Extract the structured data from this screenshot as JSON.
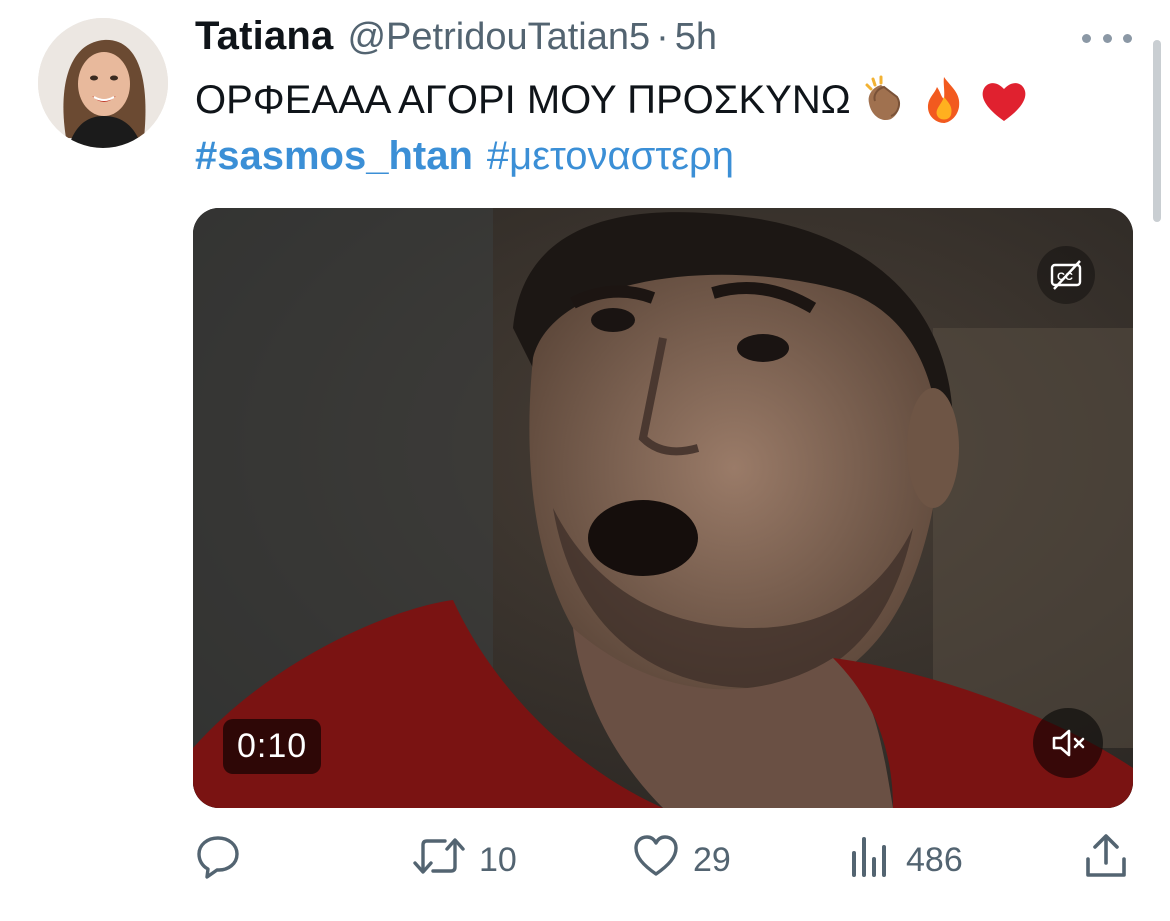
{
  "tweet": {
    "author_name": "Tatiana",
    "author_handle": "@PetridouTatian5",
    "separator": "·",
    "time": "5h",
    "text": "ΟΡΦΕΑΑΑ ΑΓΟΡΙ ΜΟΥ ΠΡΟΣΚΥΝΩ",
    "emojis": [
      "clapping-hands-emoji",
      "fire-emoji",
      "red-heart-emoji"
    ],
    "hashtags": [
      "#sasmos_htan",
      "#μετοναστερη"
    ]
  },
  "media": {
    "type": "video",
    "duration": "0:10",
    "captions_icon": "captions-off-icon",
    "volume_icon": "volume-muted-icon"
  },
  "actions": {
    "reply_count": "",
    "retweet_count": "10",
    "like_count": "29",
    "views_count": "486"
  },
  "colors": {
    "text": "#0f1419",
    "secondary": "#536471",
    "link": "#3b8fd6",
    "heart_red": "#e0212f"
  }
}
